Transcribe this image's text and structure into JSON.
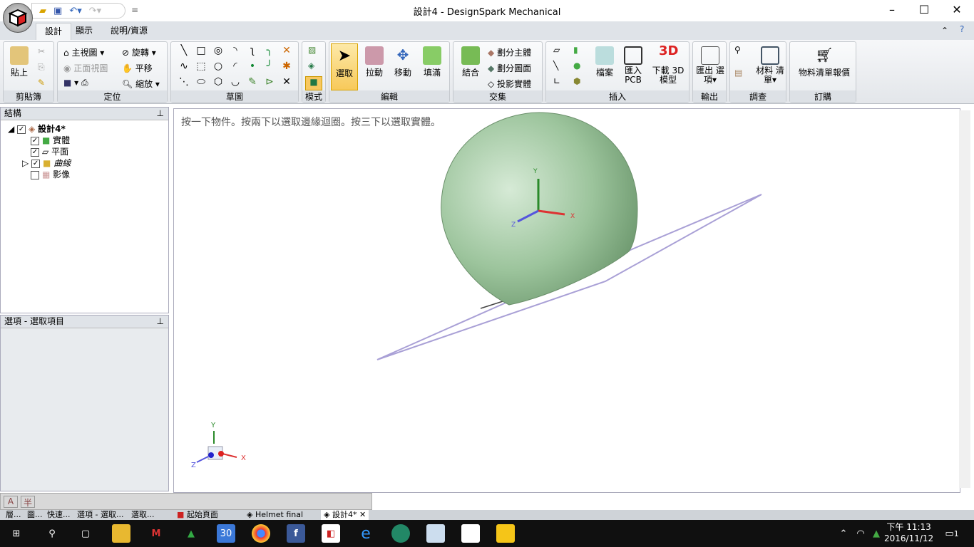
{
  "window": {
    "title": "設計4 - DesignSpark Mechanical",
    "minimize": "–",
    "maximize": "☐",
    "close": "✕"
  },
  "ribbon_tabs": [
    "設計",
    "顯示",
    "說明/資源"
  ],
  "groups": {
    "clipboard": {
      "label": "剪貼簿",
      "paste": "貼上"
    },
    "orient": {
      "label": "定位",
      "home": "主視圖",
      "front": "正面視圖",
      "spin": "旋轉",
      "pan": "平移",
      "zoom": "縮放"
    },
    "sketch": {
      "label": "草圖"
    },
    "mode": {
      "label": "模式"
    },
    "edit": {
      "label": "編輯",
      "select": "選取",
      "pull": "拉動",
      "move": "移動",
      "fill": "填滿"
    },
    "intersect": {
      "label": "交集",
      "combine": "結合",
      "split_body": "劃分主體",
      "split_face": "劃分圖面",
      "project": "投影實體"
    },
    "insert": {
      "label": "插入",
      "file": "檔案",
      "import_pcb": "匯入 PCB",
      "download_3d": "下載 3D 模型"
    },
    "output": {
      "label": "輸出",
      "export": "匯出 選項"
    },
    "investigate": {
      "label": "調查",
      "bom": "材料 清單"
    },
    "order": {
      "label": "訂購",
      "bom_quote": "物料清單報價"
    }
  },
  "structure": {
    "title": "結構",
    "root": "設計4*",
    "items": [
      "實體",
      "平面",
      "曲線",
      "影像"
    ],
    "checked": [
      true,
      true,
      true,
      false
    ]
  },
  "options": {
    "title": "選項 - 選取項目"
  },
  "viewport": {
    "hint": "按一下物件。按兩下以選取邊緣迴圈。按三下以選取實體。",
    "axes": {
      "x": "X",
      "y": "Y",
      "z": "Z"
    }
  },
  "statusbar": {
    "ime1": "A",
    "ime2": "半"
  },
  "doc_tabs": [
    "層...",
    "圖...",
    "快速...",
    "選項 - 選取...",
    "選取...",
    "起始頁面",
    "Helmet final",
    "設計4*"
  ],
  "taskbar": {
    "calendar": "30",
    "time": "下午 11:13",
    "date": "2016/11/12",
    "notifications": "1"
  }
}
